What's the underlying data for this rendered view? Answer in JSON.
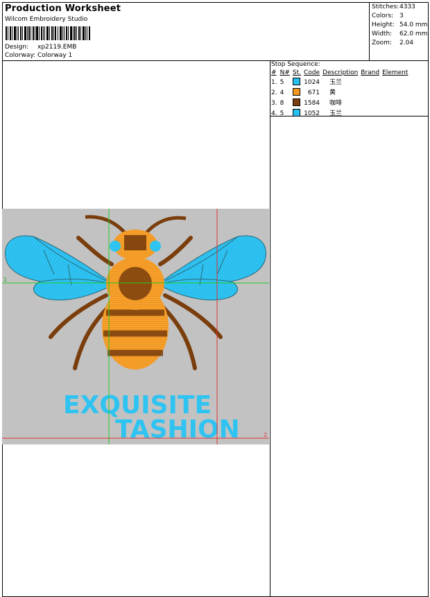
{
  "header": {
    "title": "Production Worksheet",
    "software": "Wilcom Embroidery Studio",
    "design_label": "Design:",
    "design_value": "xp2119.EMB",
    "colorway_label": "Colorway:",
    "colorway_value": "Colorway 1"
  },
  "stats": [
    {
      "label": "Stitches:",
      "value": "4333"
    },
    {
      "label": "Colors:",
      "value": "3"
    },
    {
      "label": "Height:",
      "value": "54.0 mm"
    },
    {
      "label": "Width:",
      "value": "62.0 mm"
    },
    {
      "label": "Zoom:",
      "value": "2.04"
    }
  ],
  "stop_sequence": {
    "title": "Stop Sequence:",
    "columns": [
      "#",
      "N#",
      "St.",
      "Code",
      "Description",
      "Brand",
      "Element"
    ],
    "rows": [
      {
        "idx": "1.",
        "needle": "5",
        "code": "1024",
        "description": "玉兰",
        "color": "#27c0f0"
      },
      {
        "idx": "2.",
        "needle": "4",
        "code": "671",
        "description": "黄",
        "color": "#f59a26"
      },
      {
        "idx": "3.",
        "needle": "8",
        "code": "1584",
        "description": "咖啡",
        "color": "#7a3f10"
      },
      {
        "idx": "4.",
        "needle": "5",
        "code": "1052",
        "description": "玉兰",
        "color": "#27c0f0"
      }
    ]
  },
  "design": {
    "text_line1": "EXQUISITE",
    "text_line2": "TASHION",
    "marker_1": "1",
    "marker_2": "2",
    "colors": {
      "blue": "#2fc3f2",
      "orange": "#f8a02c",
      "brown": "#7a3d0c",
      "background": "#c2c2c2",
      "guide_green": "#22cc22",
      "guide_red": "#e03030"
    }
  }
}
